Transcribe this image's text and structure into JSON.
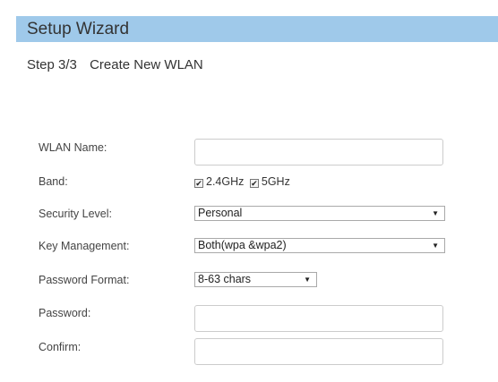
{
  "header": {
    "title": "Setup Wizard"
  },
  "step": {
    "number": "Step 3/3",
    "title": "Create New WLAN"
  },
  "form": {
    "wlan_name": {
      "label": "WLAN Name:",
      "value": "",
      "placeholder": ""
    },
    "band": {
      "label": "Band:",
      "options": [
        {
          "label": "2.4GHz",
          "checked": true,
          "check_glyph": "✔"
        },
        {
          "label": "5GHz",
          "checked": true,
          "check_glyph": "✔"
        }
      ]
    },
    "security_level": {
      "label": "Security Level:",
      "selected": "Personal"
    },
    "key_management": {
      "label": "Key Management:",
      "selected": "Both(wpa &wpa2)"
    },
    "password_format": {
      "label": "Password Format:",
      "selected": "8-63 chars"
    },
    "password": {
      "label": "Password:",
      "value": ""
    },
    "confirm": {
      "label": "Confirm:",
      "value": ""
    }
  },
  "icons": {
    "dropdown_arrow": "▼"
  },
  "colors": {
    "header_bg": "#9fc9ea",
    "input_border": "#cccccc"
  }
}
